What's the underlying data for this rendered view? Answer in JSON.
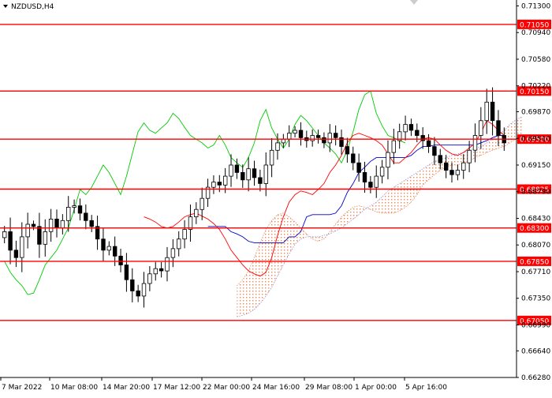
{
  "header": {
    "symbol_label": "NZDUSD,H4",
    "menu_icon": "triangle-down-icon"
  },
  "colors": {
    "level_line": "#ff0000",
    "level_label_bg": "#ff0000",
    "level_label_text": "#ffffff",
    "candle": "#000000",
    "tenkan": "#ff0000",
    "kijun": "#0000cc",
    "chikou": "#00cc00",
    "cloud_up": "#e8895a",
    "cloud_down": "#9a8fd8",
    "axis": "#000000"
  },
  "chart_data": {
    "type": "candlestick",
    "title": "NZDUSD,H4",
    "ylim": [
      0.6628,
      0.7138
    ],
    "y_ticks": [
      "0.71300",
      "0.70940",
      "0.70580",
      "0.70220",
      "0.69870",
      "0.69510",
      "0.69150",
      "0.68790",
      "0.68430",
      "0.68070",
      "0.67710",
      "0.67350",
      "0.66990",
      "0.66640",
      "0.66280"
    ],
    "x_ticks": [
      "7 Mar 2022",
      "10 Mar 08:00",
      "14 Mar 20:00",
      "17 Mar 12:00",
      "22 Mar 00:00",
      "24 Mar 16:00",
      "29 Mar 08:00",
      "1 Apr 00:00",
      "5 Apr 16:00"
    ],
    "levels": [
      {
        "label": "0.71050",
        "value": 0.7105
      },
      {
        "label": "0.70150",
        "value": 0.7015
      },
      {
        "label": "0.69500",
        "value": 0.695
      },
      {
        "label": "0.68825",
        "value": 0.68825
      },
      {
        "label": "0.68300",
        "value": 0.683
      },
      {
        "label": "0.67850",
        "value": 0.6785
      },
      {
        "label": "0.67050",
        "value": 0.6705
      }
    ],
    "close": [
      0.6825,
      0.68,
      0.679,
      0.6818,
      0.6835,
      0.6832,
      0.6808,
      0.6825,
      0.6842,
      0.683,
      0.684,
      0.6858,
      0.686,
      0.685,
      0.684,
      0.6832,
      0.6815,
      0.68,
      0.6805,
      0.6792,
      0.678,
      0.676,
      0.6745,
      0.6738,
      0.6755,
      0.6768,
      0.6775,
      0.6772,
      0.679,
      0.6802,
      0.6815,
      0.6828,
      0.6845,
      0.6855,
      0.687,
      0.6885,
      0.6892,
      0.6888,
      0.69,
      0.6915,
      0.6905,
      0.6895,
      0.691,
      0.6898,
      0.689,
      0.6915,
      0.6935,
      0.6945,
      0.695,
      0.6958,
      0.6962,
      0.6952,
      0.6948,
      0.6955,
      0.6952,
      0.6945,
      0.6958,
      0.6952,
      0.694,
      0.693,
      0.6918,
      0.6905,
      0.6892,
      0.6885,
      0.69,
      0.6912,
      0.6932,
      0.6948,
      0.696,
      0.697,
      0.6962,
      0.6955,
      0.6948,
      0.694,
      0.6928,
      0.6918,
      0.6908,
      0.6902,
      0.6908,
      0.6918,
      0.6935,
      0.6955,
      0.6975,
      0.7,
      0.6975,
      0.6955,
      0.6945
    ],
    "tenkan": [
      0.6845,
      0.6842,
      0.6838,
      0.6832,
      0.683,
      0.6832,
      0.6838,
      0.6845,
      0.6848,
      0.685,
      0.6846,
      0.6842,
      0.6836,
      0.6828,
      0.6815,
      0.68,
      0.679,
      0.678,
      0.6772,
      0.6768,
      0.6765,
      0.677,
      0.679,
      0.682,
      0.6845,
      0.6865,
      0.6875,
      0.688,
      0.6878,
      0.6875,
      0.6882,
      0.689,
      0.6905,
      0.6915,
      0.6928,
      0.6945,
      0.6955,
      0.6958,
      0.6955,
      0.6952,
      0.6948,
      0.6942,
      0.693,
      0.6918,
      0.6918,
      0.6925,
      0.6932,
      0.6942,
      0.695,
      0.6952,
      0.695,
      0.6942,
      0.6935,
      0.693,
      0.6928,
      0.6932,
      0.6938,
      0.6945,
      0.6958,
      0.6975,
      0.697,
      0.6962,
      0.6955
    ],
    "kijun": [
      0.6832,
      0.6832,
      0.6832,
      0.6832,
      0.6825,
      0.6822,
      0.6818,
      0.6812,
      0.681,
      0.681,
      0.681,
      0.681,
      0.681,
      0.681,
      0.6818,
      0.6818,
      0.6825,
      0.6845,
      0.6848,
      0.6848,
      0.6848,
      0.6848,
      0.685,
      0.686,
      0.6878,
      0.689,
      0.6905,
      0.6912,
      0.692,
      0.6925,
      0.6925,
      0.6925,
      0.6925,
      0.6925,
      0.6925,
      0.6928,
      0.6935,
      0.694,
      0.694,
      0.6942,
      0.6942,
      0.6942,
      0.6942,
      0.6942,
      0.6942,
      0.6942,
      0.6942,
      0.6945,
      0.6948,
      0.6952,
      0.6955,
      0.6955
    ],
    "chikou": [
      0.6785,
      0.677,
      0.676,
      0.6752,
      0.674,
      0.6742,
      0.676,
      0.678,
      0.679,
      0.68,
      0.6815,
      0.683,
      0.6855,
      0.6882,
      0.6875,
      0.6885,
      0.69,
      0.6915,
      0.6905,
      0.689,
      0.6875,
      0.69,
      0.693,
      0.696,
      0.6972,
      0.6962,
      0.6958,
      0.6965,
      0.6972,
      0.6985,
      0.6978,
      0.6966,
      0.6955,
      0.695,
      0.6945,
      0.6938,
      0.6942,
      0.6955,
      0.6942,
      0.6925,
      0.6918,
      0.6912,
      0.6925,
      0.6945,
      0.6975,
      0.699,
      0.6965,
      0.695,
      0.6938,
      0.695,
      0.697,
      0.6982,
      0.6975,
      0.6965,
      0.6955,
      0.6945,
      0.6938,
      0.693,
      0.6918,
      0.6935,
      0.696,
      0.699,
      0.701,
      0.7015,
      0.6985,
      0.6968,
      0.6955,
      0.6952,
      0.6948,
      0.6945
    ],
    "span_a": [
      0.6752,
      0.676,
      0.6772,
      0.679,
      0.681,
      0.6828,
      0.684,
      0.6848,
      0.685,
      0.6845,
      0.6838,
      0.683,
      0.6822,
      0.6815,
      0.6812,
      0.6815,
      0.6825,
      0.6835,
      0.6845,
      0.6852,
      0.6858,
      0.686,
      0.6858,
      0.6855,
      0.6852,
      0.685,
      0.685,
      0.685,
      0.6853,
      0.6858,
      0.6865,
      0.6875,
      0.6888,
      0.6895,
      0.6902,
      0.6908,
      0.6912,
      0.6915,
      0.6915,
      0.6918,
      0.692,
      0.6925,
      0.6928,
      0.6932,
      0.6935,
      0.6938,
      0.694,
      0.6945,
      0.695,
      0.6955
    ],
    "span_b": [
      0.671,
      0.6712,
      0.6715,
      0.672,
      0.6728,
      0.6738,
      0.675,
      0.6765,
      0.678,
      0.6795,
      0.6808,
      0.6815,
      0.6818,
      0.6818,
      0.6818,
      0.682,
      0.6822,
      0.6826,
      0.683,
      0.6836,
      0.6842,
      0.6848,
      0.6855,
      0.686,
      0.6865,
      0.6872,
      0.688,
      0.6885,
      0.689,
      0.6895,
      0.69,
      0.6905,
      0.691,
      0.6915,
      0.692,
      0.6922,
      0.6925,
      0.6928,
      0.693,
      0.6932,
      0.6935,
      0.6938,
      0.694,
      0.6945,
      0.695,
      0.6955,
      0.6962,
      0.697,
      0.6976,
      0.698
    ]
  }
}
